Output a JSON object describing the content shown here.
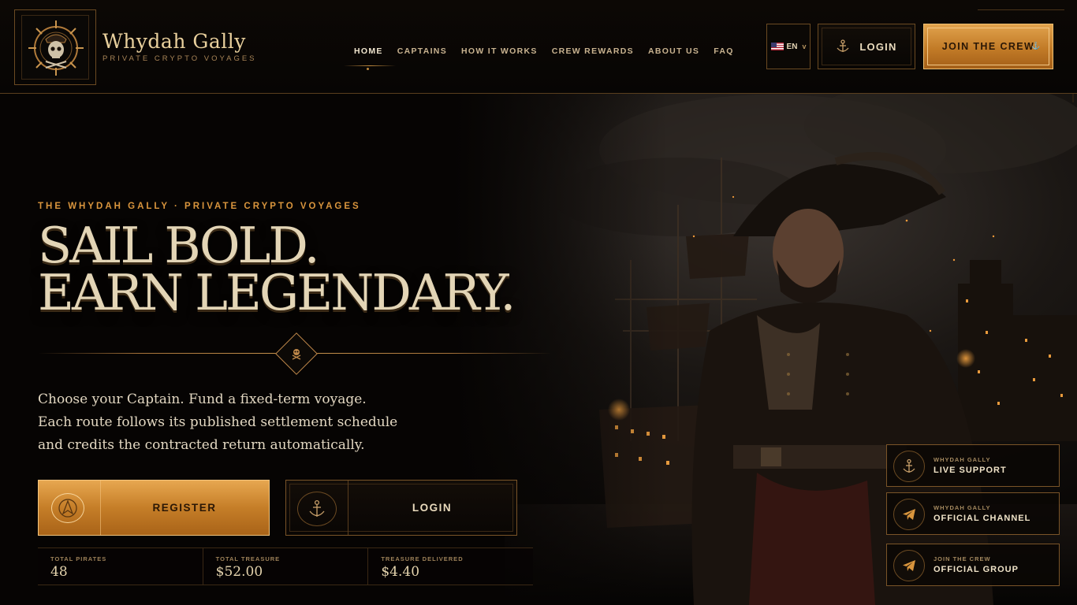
{
  "brand": {
    "name": "Whydah Gally",
    "tagline": "PRIVATE CRYPTO VOYAGES"
  },
  "nav": {
    "items": [
      {
        "label": "HOME"
      },
      {
        "label": "CAPTAINS"
      },
      {
        "label": "HOW IT WORKS"
      },
      {
        "label": "CREW REWARDS"
      },
      {
        "label": "ABOUT US"
      },
      {
        "label": "FAQ"
      }
    ],
    "active": "HOME"
  },
  "header": {
    "language": "EN",
    "login_label": "LOGIN",
    "join_label": "JOIN THE CREW"
  },
  "hero": {
    "kicker": "THE WHYDAH GALLY · PRIVATE CRYPTO VOYAGES",
    "headline_line1": "SAIL BOLD.",
    "headline_line2": "EARN LEGENDARY",
    "headline_dot": ".",
    "lead_line1": "Choose your Captain. Fund a fixed-term voyage.",
    "lead_line2": "Each route follows its published settlement schedule",
    "lead_line3": "and credits the contracted return automatically.",
    "register_label": "REGISTER",
    "login_label": "LOGIN"
  },
  "stats": [
    {
      "label": "TOTAL PIRATES",
      "value": "48"
    },
    {
      "label": "TOTAL TREASURE",
      "value": "$52.00"
    },
    {
      "label": "TREASURE DELIVERED",
      "value": "$4.40"
    }
  ],
  "contacts": [
    {
      "sub": "WHYDAH GALLY",
      "title": "LIVE SUPPORT",
      "icon": "anchor-icon"
    },
    {
      "sub": "WHYDAH GALLY",
      "title": "OFFICIAL CHANNEL",
      "icon": "telegram-icon"
    },
    {
      "sub": "JOIN THE CREW",
      "title": "OFFICIAL GROUP",
      "icon": "telegram-icon"
    }
  ],
  "colors": {
    "accent_gold": "#d9953d",
    "background": "#060403",
    "text_cream": "#e3d5b6"
  }
}
